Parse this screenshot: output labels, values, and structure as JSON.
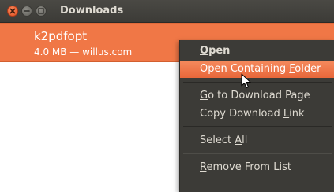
{
  "window": {
    "title": "Downloads",
    "buttons": [
      "close-icon",
      "minimize-icon",
      "maximize-icon"
    ]
  },
  "download": {
    "name": "k2pdfopt",
    "meta": "4.0 MB — willus.com"
  },
  "context_menu": {
    "items": [
      {
        "label": "Open",
        "mnemonic": "O",
        "bold": true
      },
      {
        "label": "Open Containing Folder",
        "mnemonic": "F",
        "highlighted": true
      },
      {
        "label": "Go to Download Page",
        "mnemonic": "G"
      },
      {
        "label": "Copy Download Link",
        "mnemonic": "L"
      },
      {
        "label": "Select All",
        "mnemonic": "A"
      },
      {
        "label": "Remove From List",
        "mnemonic": "R"
      }
    ]
  },
  "colors": {
    "titlebar": "#3c3b37",
    "selection": "#f07746",
    "menu_bg": "#3c3b37",
    "menu_text": "#dfdbd2",
    "highlight": "#e8673a"
  }
}
